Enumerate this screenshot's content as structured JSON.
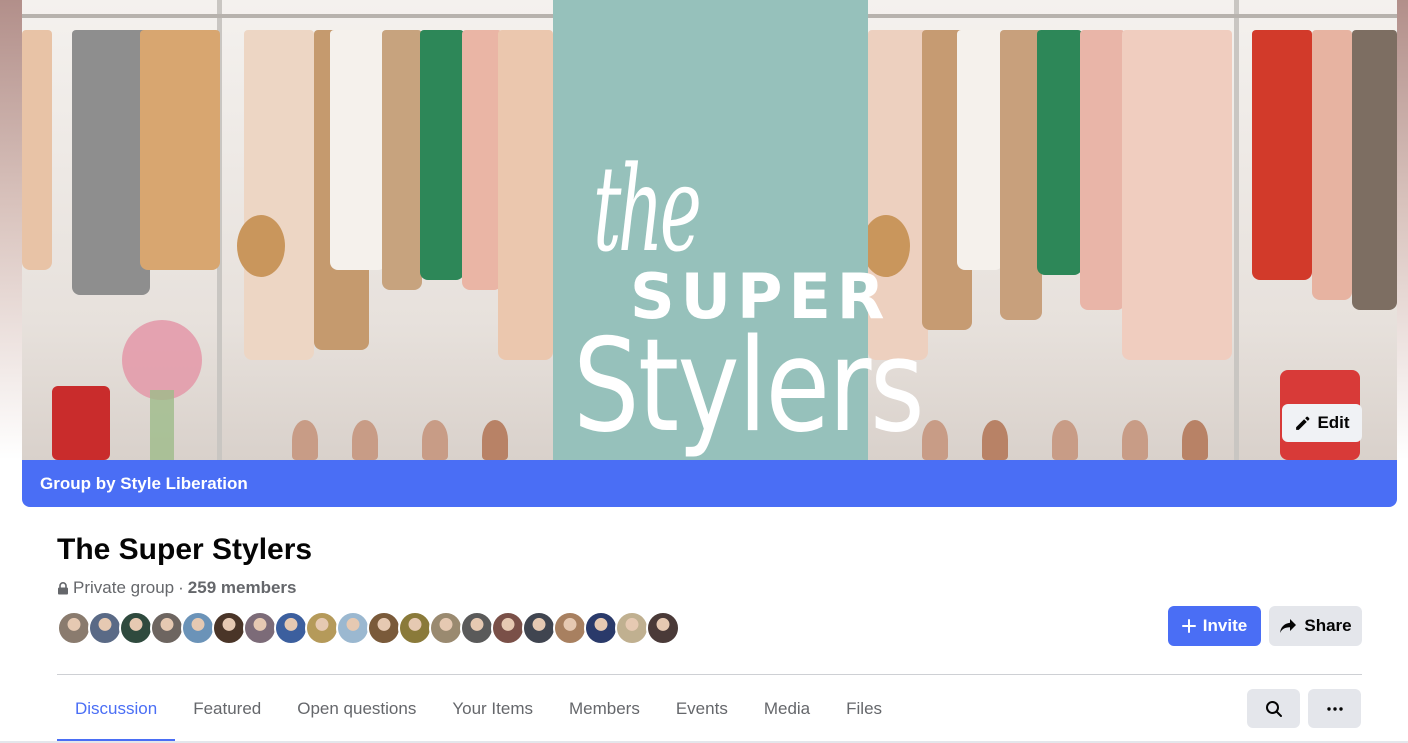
{
  "cover": {
    "logo_line1": "the",
    "logo_line2": "SUPER",
    "logo_line3": "Stylers",
    "edit_label": "Edit"
  },
  "banner": {
    "text": "Group by Style Liberation"
  },
  "group": {
    "title": "The Super Stylers",
    "privacy": "Private group",
    "separator": "·",
    "members": "259 members"
  },
  "avatars": [
    {
      "color": "#8a7b6e"
    },
    {
      "color": "#5a6a86"
    },
    {
      "color": "#2f4a3e"
    },
    {
      "color": "#6d6560"
    },
    {
      "color": "#6b93b8"
    },
    {
      "color": "#4a3528"
    },
    {
      "color": "#7c6b78"
    },
    {
      "color": "#3c5f9e"
    },
    {
      "color": "#b59a5a"
    },
    {
      "color": "#9bb8d0"
    },
    {
      "color": "#7a5a3a"
    },
    {
      "color": "#8a7a3a"
    },
    {
      "color": "#9a8a70"
    },
    {
      "color": "#5a5a5a"
    },
    {
      "color": "#7a5048"
    },
    {
      "color": "#404550"
    },
    {
      "color": "#a88060"
    },
    {
      "color": "#2a3a6a"
    },
    {
      "color": "#c0b090"
    },
    {
      "color": "#4a3a38"
    }
  ],
  "actions": {
    "invite": "Invite",
    "share": "Share"
  },
  "tabs": [
    {
      "label": "Discussion",
      "active": true
    },
    {
      "label": "Featured"
    },
    {
      "label": "Open questions"
    },
    {
      "label": "Your Items"
    },
    {
      "label": "Members"
    },
    {
      "label": "Events"
    },
    {
      "label": "Media"
    },
    {
      "label": "Files"
    }
  ],
  "icons": {
    "edit": "pencil-icon",
    "lock": "lock-icon",
    "invite": "plus-icon",
    "share": "share-arrow-icon",
    "search": "search-icon",
    "more": "more-dots-icon"
  },
  "colors": {
    "accent": "#4a6ef5",
    "teal": "#96c1bb"
  }
}
